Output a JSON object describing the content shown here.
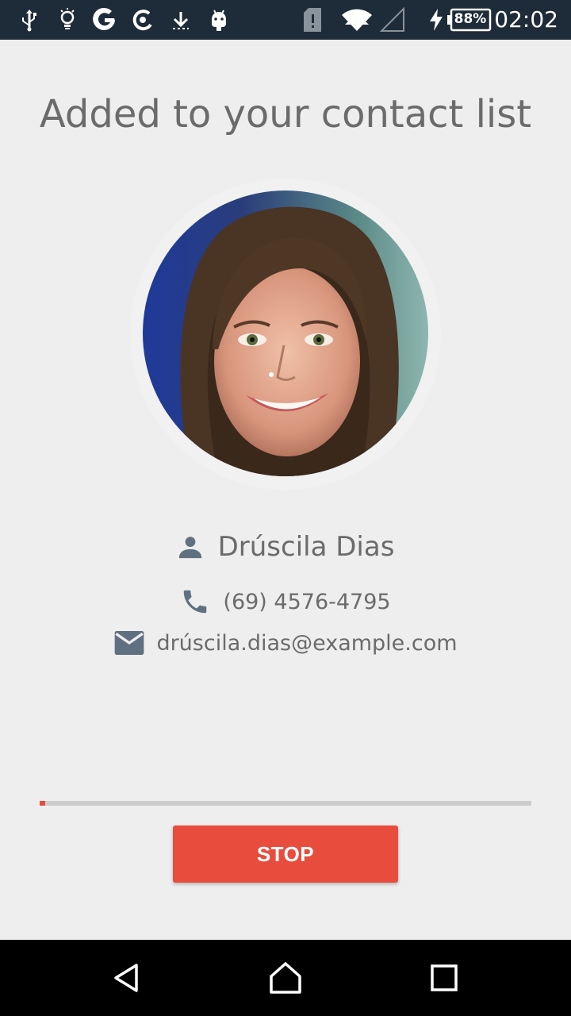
{
  "status_bar": {
    "time": "02:02",
    "battery_percent": "88%",
    "icons": [
      "usb-icon",
      "lightbulb-icon",
      "google-icon",
      "google-c-icon",
      "download-icon",
      "android-icon",
      "sim-alert-icon",
      "wifi-icon",
      "signal-empty-icon",
      "charging-bolt-icon",
      "battery-icon"
    ]
  },
  "page": {
    "title": "Added to your contact list"
  },
  "contact": {
    "name": "Drúscila Dias",
    "phone": "(69) 4576-4795",
    "email": "drúscila.dias@example.com",
    "photo_alt": "contact photo"
  },
  "progress": {
    "fraction": 0.012
  },
  "actions": {
    "stop_label": "STOP"
  },
  "nav_bar": {
    "icons": [
      "back-icon",
      "home-icon",
      "recents-icon"
    ]
  },
  "colors": {
    "accent": "#e84c3d",
    "status_bar": "#1e2b38",
    "background": "#eeeeee",
    "icon_gray": "#5f7080",
    "text_gray": "#6b6b6b"
  }
}
